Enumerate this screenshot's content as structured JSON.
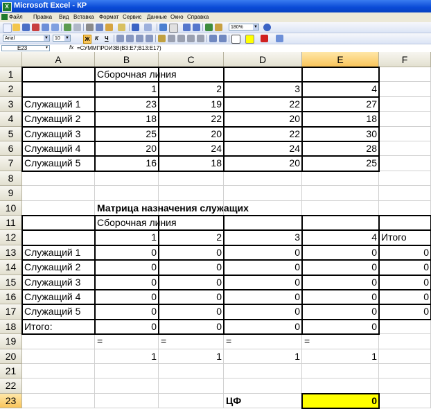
{
  "window": {
    "title": "Microsoft Excel - КР",
    "app_icon_glyph": "X"
  },
  "menu": [
    "Файл",
    "Правка",
    "Вид",
    "Вставка",
    "Формат",
    "Сервис",
    "Данные",
    "Окно",
    "Справка"
  ],
  "toolbar": {
    "zoom": "180%",
    "font": "Arial",
    "font_size": "10",
    "bold": "Ж",
    "italic": "К",
    "underline": "Ч"
  },
  "formula_bar": {
    "name_box": "E23",
    "fx": "fx",
    "formula": "=СУММПРОИЗВ(B3:E7;B13:E17)"
  },
  "columns": [
    "A",
    "B",
    "C",
    "D",
    "E",
    "F"
  ],
  "selected_cell": "E23",
  "sheet": {
    "rows": [
      {
        "n": "1",
        "A": "",
        "B": "Сборочная линия",
        "C": "",
        "D": "",
        "E": "",
        "F": ""
      },
      {
        "n": "2",
        "A": "",
        "B": "1",
        "C": "2",
        "D": "3",
        "E": "4",
        "F": ""
      },
      {
        "n": "3",
        "A": "Служащий 1",
        "B": "23",
        "C": "19",
        "D": "22",
        "E": "27",
        "F": ""
      },
      {
        "n": "4",
        "A": "Служащий 2",
        "B": "18",
        "C": "22",
        "D": "20",
        "E": "18",
        "F": ""
      },
      {
        "n": "5",
        "A": "Служащий 3",
        "B": "25",
        "C": "20",
        "D": "22",
        "E": "30",
        "F": ""
      },
      {
        "n": "6",
        "A": "Служащий 4",
        "B": "20",
        "C": "24",
        "D": "24",
        "E": "28",
        "F": ""
      },
      {
        "n": "7",
        "A": "Служащий 5",
        "B": "16",
        "C": "18",
        "D": "20",
        "E": "25",
        "F": ""
      },
      {
        "n": "8",
        "A": "",
        "B": "",
        "C": "",
        "D": "",
        "E": "",
        "F": ""
      },
      {
        "n": "9",
        "A": "",
        "B": "",
        "C": "",
        "D": "",
        "E": "",
        "F": ""
      },
      {
        "n": "10",
        "A": "",
        "B": "Матрица назначения служащих",
        "C": "",
        "D": "",
        "E": "",
        "F": ""
      },
      {
        "n": "11",
        "A": "",
        "B": "Сборочная линия",
        "C": "",
        "D": "",
        "E": "",
        "F": ""
      },
      {
        "n": "12",
        "A": "",
        "B": "1",
        "C": "2",
        "D": "3",
        "E": "4",
        "F": "Итого"
      },
      {
        "n": "13",
        "A": "Служащий 1",
        "B": "0",
        "C": "0",
        "D": "0",
        "E": "0",
        "F": "0"
      },
      {
        "n": "14",
        "A": "Служащий 2",
        "B": "0",
        "C": "0",
        "D": "0",
        "E": "0",
        "F": "0"
      },
      {
        "n": "15",
        "A": "Служащий 3",
        "B": "0",
        "C": "0",
        "D": "0",
        "E": "0",
        "F": "0"
      },
      {
        "n": "16",
        "A": "Служащий 4",
        "B": "0",
        "C": "0",
        "D": "0",
        "E": "0",
        "F": "0"
      },
      {
        "n": "17",
        "A": "Служащий 5",
        "B": "0",
        "C": "0",
        "D": "0",
        "E": "0",
        "F": "0"
      },
      {
        "n": "18",
        "A": "Итого:",
        "B": "0",
        "C": "0",
        "D": "0",
        "E": "0",
        "F": ""
      },
      {
        "n": "19",
        "A": "",
        "B": "=",
        "C": "=",
        "D": "=",
        "E": "=",
        "F": ""
      },
      {
        "n": "20",
        "A": "",
        "B": "1",
        "C": "1",
        "D": "1",
        "E": "1",
        "F": ""
      },
      {
        "n": "21",
        "A": "",
        "B": "",
        "C": "",
        "D": "",
        "E": "",
        "F": ""
      },
      {
        "n": "22",
        "A": "",
        "B": "",
        "C": "",
        "D": "",
        "E": "",
        "F": ""
      },
      {
        "n": "23",
        "A": "",
        "B": "",
        "C": "",
        "D": "ЦФ",
        "E": "0",
        "F": ""
      }
    ]
  },
  "colors": {
    "titlebar": "#0a4ad6",
    "highlight": "#ffff00",
    "selection_header": "#f9c55b"
  }
}
